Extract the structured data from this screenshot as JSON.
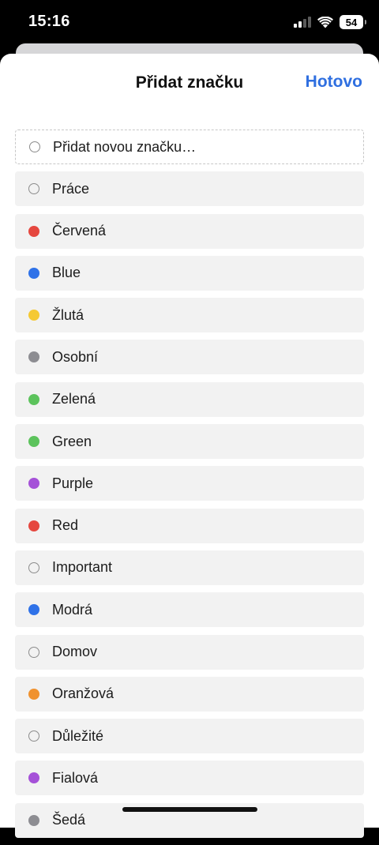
{
  "status_bar": {
    "time": "15:16",
    "battery": "54"
  },
  "sheet": {
    "title": "Přidat značku",
    "done_label": "Hotovo"
  },
  "add_tag": {
    "label": "Přidat novou značku…"
  },
  "tags": [
    {
      "label": "Práce",
      "color": null
    },
    {
      "label": "Červená",
      "color": "#e5473f"
    },
    {
      "label": "Blue",
      "color": "#2f72e8"
    },
    {
      "label": "Žlutá",
      "color": "#f5c933"
    },
    {
      "label": "Osobní",
      "color": "#8d8d92"
    },
    {
      "label": "Zelená",
      "color": "#5cc35c"
    },
    {
      "label": "Green",
      "color": "#5cc35c"
    },
    {
      "label": "Purple",
      "color": "#a551d8"
    },
    {
      "label": "Red",
      "color": "#e5473f"
    },
    {
      "label": "Important",
      "color": null
    },
    {
      "label": "Modrá",
      "color": "#2f72e8"
    },
    {
      "label": "Domov",
      "color": null
    },
    {
      "label": "Oranžová",
      "color": "#f0922f"
    },
    {
      "label": "Důležité",
      "color": null
    },
    {
      "label": "Fialová",
      "color": "#a551d8"
    },
    {
      "label": "Šedá",
      "color": "#8d8d92"
    }
  ]
}
